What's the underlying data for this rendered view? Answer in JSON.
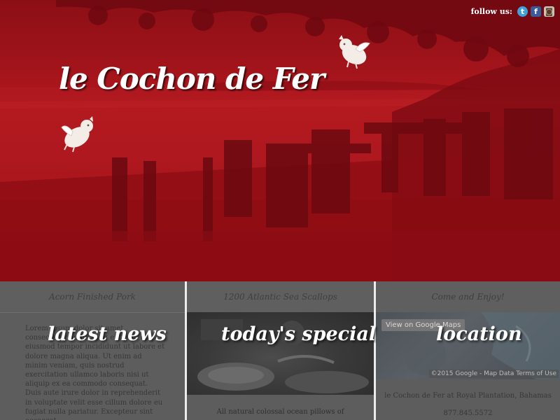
{
  "header": {
    "follow_label": "follow us:",
    "social": [
      {
        "name": "twitter",
        "glyph": "t"
      },
      {
        "name": "facebook",
        "glyph": "f"
      },
      {
        "name": "instagram",
        "glyph": "◙"
      }
    ],
    "logo": "le Cochon de Fer"
  },
  "columns": {
    "news": {
      "title": "Acorn Finished Pork",
      "heading": "latest news",
      "body": "Lorem ipsum dolor sit amet, consectetur adipisicing elit, sed do eiusmod tempor incididunt ut labore et dolore magna aliqua. Ut enim ad minim veniam, quis nostrud exercitation ullamco laboris nisi ut aliquip ex ea commodo consequat. Duis aute irure dolor in reprehenderit in voluptate velit esse cillum dolore eu fugiat nulla pariatur. Excepteur sint occaecat"
    },
    "special": {
      "title": "1200 Atlantic Sea Scallops",
      "heading": "today's special",
      "body": "All natural colossal ocean pillows of"
    },
    "location": {
      "title": "Come and Enjoy!",
      "heading": "location",
      "map_link": "View on Google Maps",
      "map_credit": "©2015 Google - Map Data  Terms of Use",
      "address": "le Cochon de Fer at Royal Plantation, Bahamas",
      "phone": "877.845.5572"
    }
  },
  "colors": {
    "hero_red": "#a3141b",
    "column_gray": "#5d5d5d",
    "divider": "#ececec"
  }
}
